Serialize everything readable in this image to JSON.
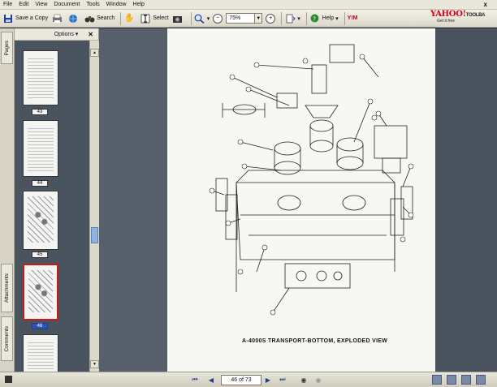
{
  "menu": {
    "items": [
      "File",
      "Edit",
      "View",
      "Document",
      "Tools",
      "Window",
      "Help"
    ],
    "close": "x"
  },
  "toolbar": {
    "save_copy": "Save a Copy",
    "search": "Search",
    "select": "Select",
    "zoom_value": "75%",
    "help": "Help",
    "ym": "Y!M"
  },
  "yahoo": {
    "logo": "YAHOO!",
    "toolbar": "TOOLBA",
    "get_it_free": "Get it free"
  },
  "tabs": {
    "pages": "Pages",
    "attachments": "Attachments",
    "comments": "Comments"
  },
  "pages_panel": {
    "options": "Options ▾",
    "close": "✕",
    "thumbnails": [
      {
        "num": "43",
        "selected": false
      },
      {
        "num": "44",
        "selected": false
      },
      {
        "num": "45",
        "selected": false
      },
      {
        "num": "46",
        "selected": true
      }
    ]
  },
  "document": {
    "caption": "A-4000S TRANSPORT-BOTTOM, EXPLODED VIEW"
  },
  "status": {
    "page_indicator": "46 of 73"
  }
}
